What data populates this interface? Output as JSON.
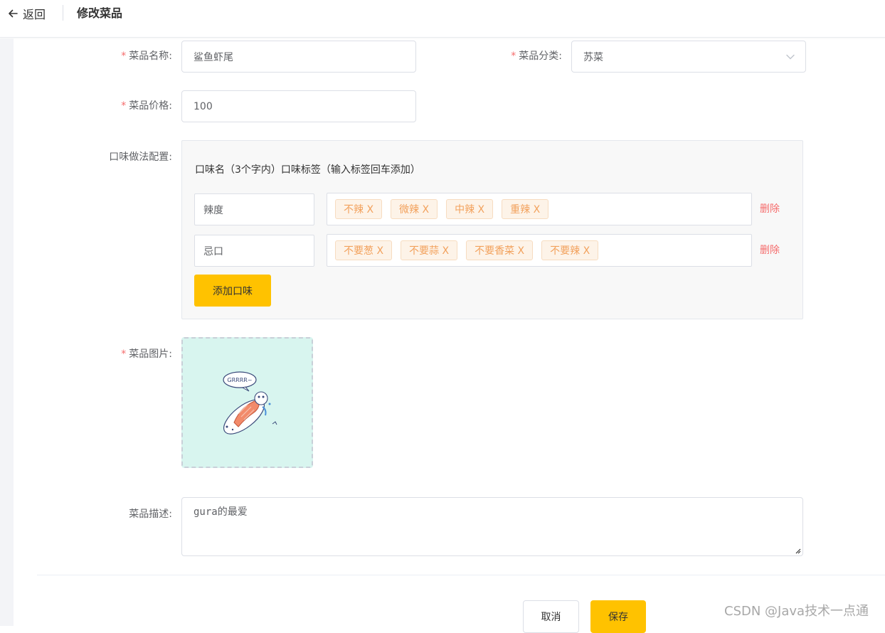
{
  "header": {
    "back_label": "返回",
    "title": "修改菜品"
  },
  "form": {
    "required_mark": "*",
    "name": {
      "label": "菜品名称:",
      "value": "鲨鱼虾尾"
    },
    "category": {
      "label": "菜品分类:",
      "value": "苏菜"
    },
    "price": {
      "label": "菜品价格:",
      "value": "100"
    },
    "flavor": {
      "label": "口味做法配置:",
      "header": "口味名（3个字内）口味标签（输入标签回车添加）",
      "rows": [
        {
          "name": "辣度",
          "tags": [
            "不辣 X",
            "微辣 X",
            "中辣 X",
            "重辣 X"
          ],
          "delete_label": "删除"
        },
        {
          "name": "忌口",
          "tags": [
            "不要葱 X",
            "不要蒜 X",
            "不要香菜 X",
            "不要辣 X"
          ],
          "delete_label": "删除"
        }
      ],
      "add_label": "添加口味"
    },
    "image": {
      "label": "菜品图片:",
      "bubble_text": "GRRRR~"
    },
    "description": {
      "label": "菜品描述:",
      "value": "gura的最爱"
    }
  },
  "footer": {
    "cancel_label": "取消",
    "save_label": "保存"
  },
  "watermark": "CSDN @Java技术一点通",
  "colors": {
    "accent": "#ffc200",
    "required": "#f56c6c",
    "tag_text": "#f2a15c",
    "tag_bg": "#fdf3e8",
    "upload_bg": "#d8f5ef"
  },
  "icons": {
    "back": "arrow-left-icon",
    "select": "chevron-down-icon"
  }
}
